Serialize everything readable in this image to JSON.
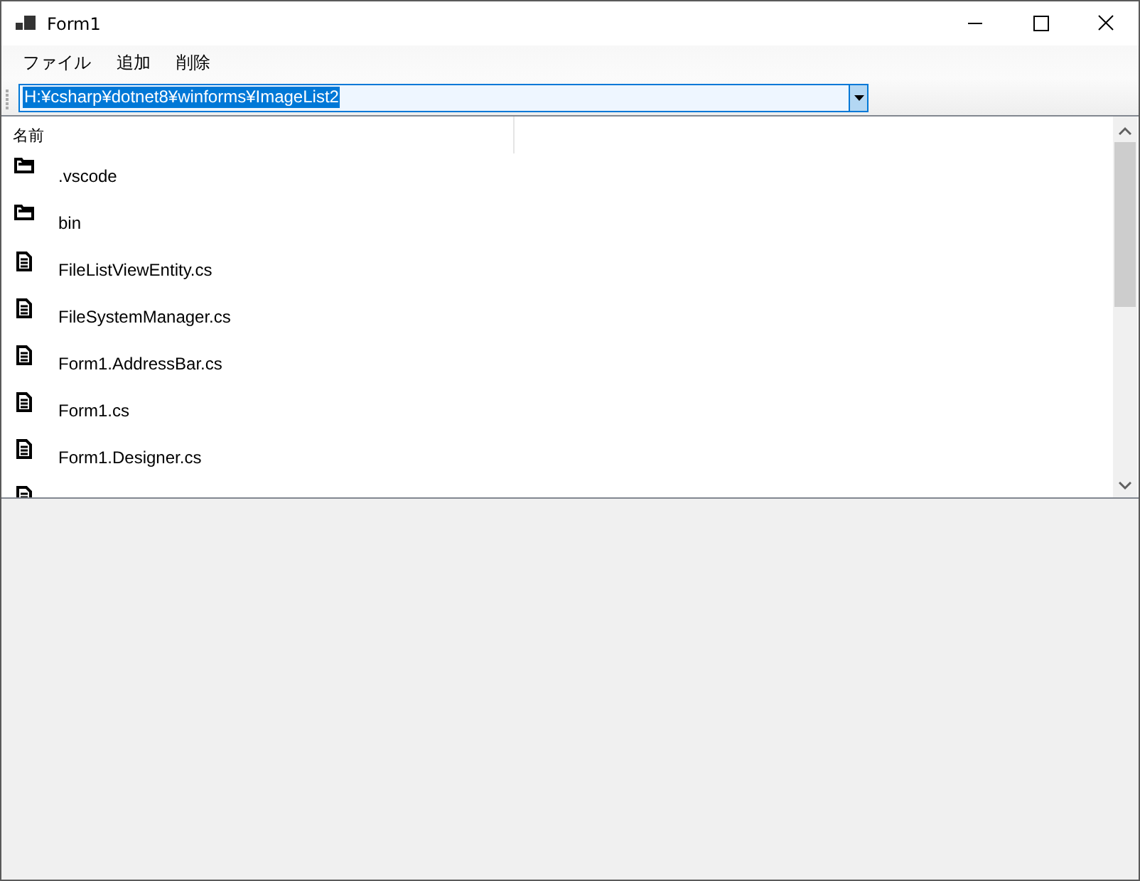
{
  "window": {
    "title": "Form1"
  },
  "menu": [
    "ファイル",
    "追加",
    "削除"
  ],
  "address": {
    "value": "H:¥csharp¥dotnet8¥winforms¥ImageList2",
    "text_selected": true
  },
  "list": {
    "columns": [
      "名前"
    ],
    "items": [
      {
        "kind": "folder",
        "name": ".vscode"
      },
      {
        "kind": "folder",
        "name": "bin"
      },
      {
        "kind": "file",
        "name": "FileListViewEntity.cs"
      },
      {
        "kind": "file",
        "name": "FileSystemManager.cs"
      },
      {
        "kind": "file",
        "name": "Form1.AddressBar.cs"
      },
      {
        "kind": "file",
        "name": "Form1.cs"
      },
      {
        "kind": "file",
        "name": "Form1.Designer.cs"
      },
      {
        "kind": "file"
      }
    ]
  }
}
